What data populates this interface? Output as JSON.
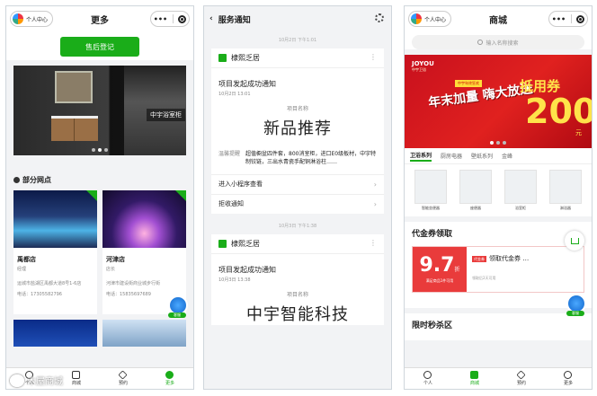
{
  "colors": {
    "accent_green": "#1aad19",
    "banner_red": "#e0211f",
    "coupon_red": "#e93b3b"
  },
  "phone1": {
    "pill_label": "个人中心",
    "title": "更多",
    "capsule_more": "•••",
    "aftersale_button": "售后登记",
    "hero_caption": "中宇浴室柜",
    "section_title": "部分网点",
    "stores": [
      {
        "name": "禹都店",
        "role": "经理",
        "address": "运城市盐湖区禹都大道8号1-6店",
        "tel": "电话：17305582796"
      },
      {
        "name": "河津店",
        "role": "店长",
        "address": "河津市建设街商业城步行街",
        "tel": "电话：15835697689"
      }
    ],
    "cs_tag": "客服",
    "tabs": [
      {
        "label": "个人"
      },
      {
        "label": "商城"
      },
      {
        "label": "预约"
      },
      {
        "label": "更多"
      }
    ]
  },
  "phone2": {
    "title": "服务通知",
    "notices": [
      {
        "date_sep": "10月2日 下午1:01",
        "app": "棣熙乏居",
        "title": "项目发起成功通知",
        "time": "10月2日 13:01",
        "label": "项目名称",
        "project": "新品推荐",
        "remark_key": "温馨提醒",
        "remark": "超值橱盆四件套，800消室柜，进口E0级板材，中宇特制铰链，三出水青瓷手配铜淋浴柱……",
        "link1": "进入小程序查看",
        "link2": "拒收通知"
      },
      {
        "date_sep": "10月3日 下午1:38",
        "app": "棣熙乏居",
        "title": "项目发起成功通知",
        "time": "10月3日 13:38",
        "label": "项目名称",
        "project": "中宇智能科技"
      }
    ]
  },
  "phone3": {
    "pill_label": "个人中心",
    "title": "商城",
    "search_placeholder": "输入名称搜索",
    "banner": {
      "brand": "JOYOU",
      "brand_sub": "中宇卫浴",
      "ribbon": "中宇年终狂欢",
      "slogan": "年末加量 嗨大放送",
      "coupon_word": "抵用券",
      "coupon_value": "200",
      "unit": "元"
    },
    "categories": [
      "卫浴系列",
      "厨房电器",
      "壁纸系列",
      "金峰"
    ],
    "products": [
      "智能坐便器",
      "座便器",
      "浴室柜",
      "淋浴器"
    ],
    "coupon_section_title": "代金券领取",
    "coupon": {
      "value": "9.7",
      "unit": "折",
      "condition": "满足商品1件可用",
      "badge": "代金券",
      "name": "领取代金券 …",
      "expiry": "领取后2天可用"
    },
    "cart_label": "购物车",
    "seckill_title": "限时秒杀区",
    "tabs": [
      {
        "label": "个人"
      },
      {
        "label": "商城"
      },
      {
        "label": "预约"
      },
      {
        "label": "更多"
      }
    ]
  },
  "watermark": "木屋商城"
}
